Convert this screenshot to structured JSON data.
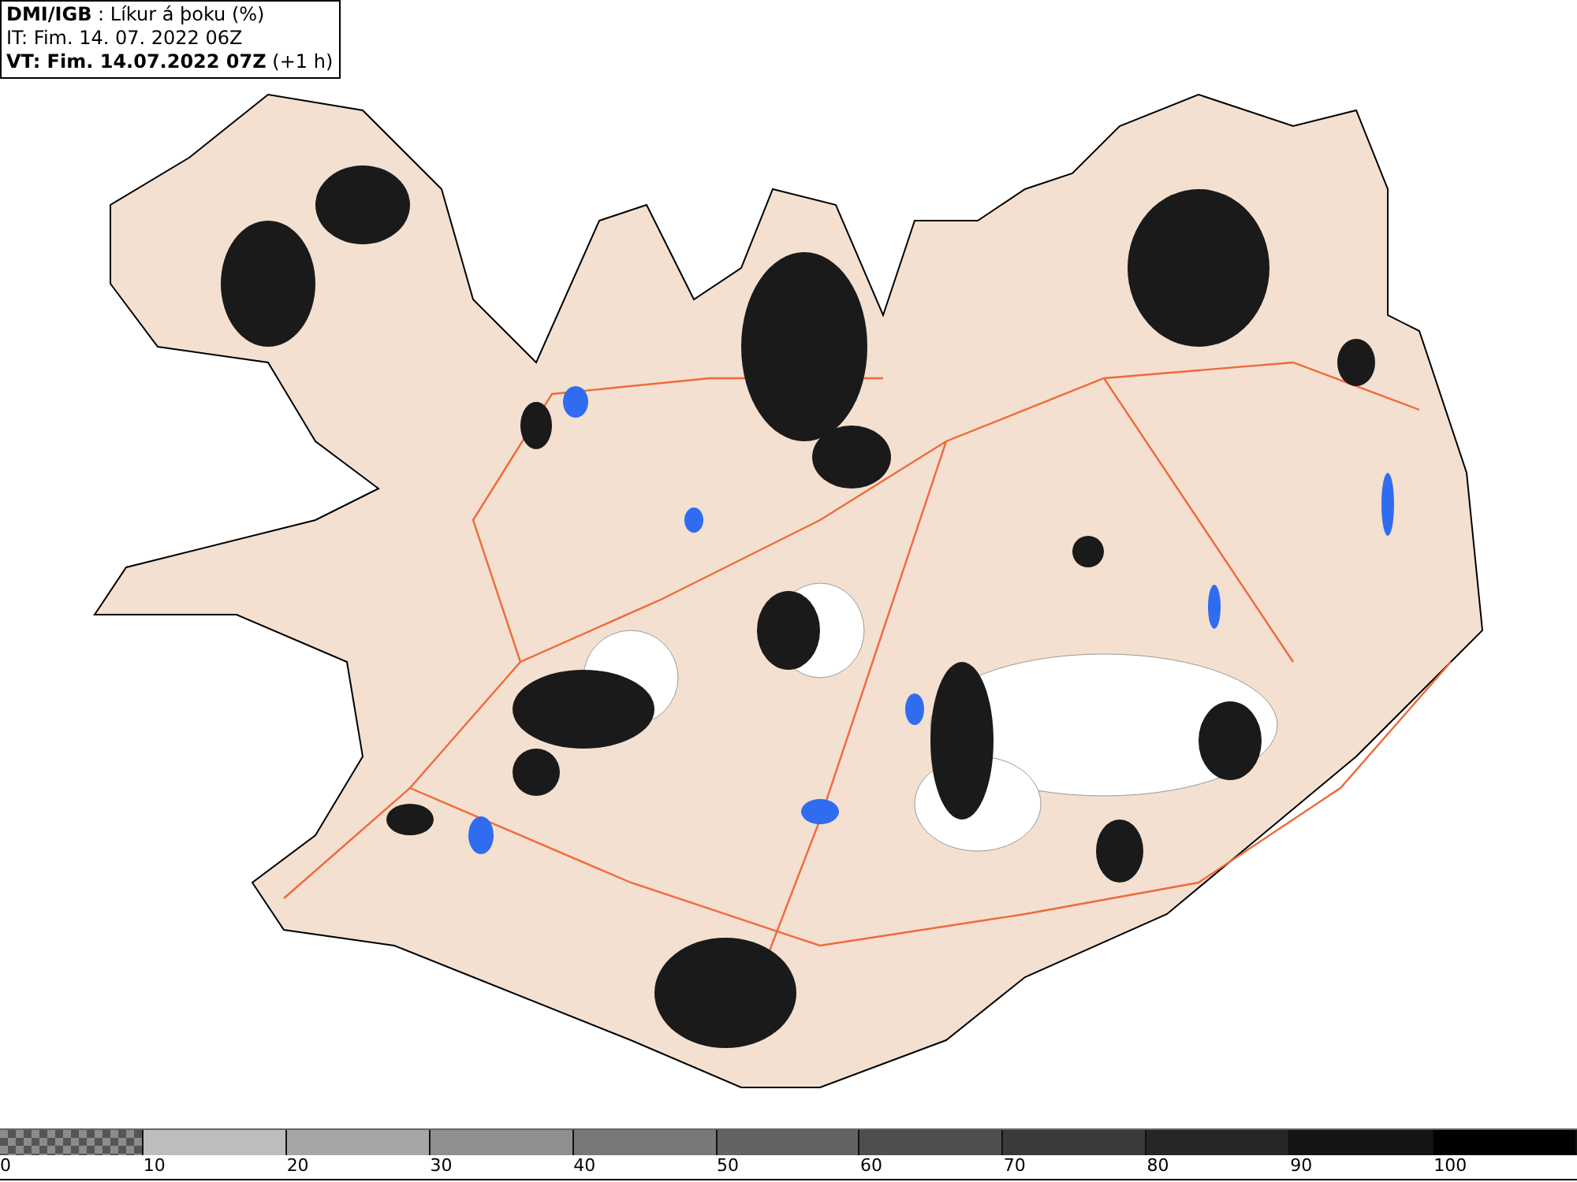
{
  "header": {
    "lines": [
      "**DMI/IGB** : Líkur á þoku (%)",
      "IT: Fim. 14. 07. 2022 06Z",
      "**VT: Fim. 14.07.2022 07Z** (+1 h)"
    ]
  },
  "legend": {
    "segments": [
      {
        "kind": "checkered",
        "color": "#555555"
      },
      {
        "kind": "solid",
        "color": "#bdbdbd"
      },
      {
        "kind": "solid",
        "color": "#a6a6a6"
      },
      {
        "kind": "solid",
        "color": "#8f8f8f"
      },
      {
        "kind": "solid",
        "color": "#787878"
      },
      {
        "kind": "solid",
        "color": "#636363"
      },
      {
        "kind": "solid",
        "color": "#4e4e4e"
      },
      {
        "kind": "solid",
        "color": "#3a3a3a"
      },
      {
        "kind": "solid",
        "color": "#262626"
      },
      {
        "kind": "solid",
        "color": "#141414"
      },
      {
        "kind": "solid",
        "color": "#000000"
      }
    ],
    "labels": [
      "0",
      "10",
      "20",
      "30",
      "40",
      "50",
      "60",
      "70",
      "80",
      "90",
      "100"
    ]
  }
}
